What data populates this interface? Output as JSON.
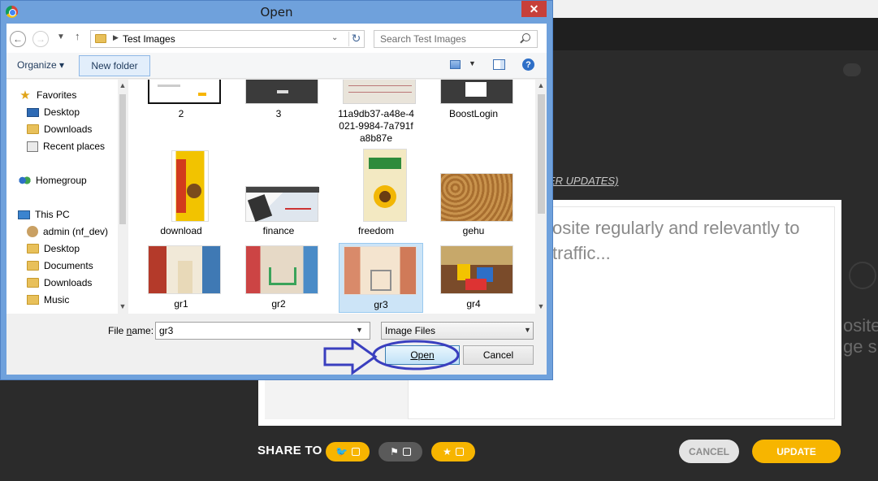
{
  "dialog": {
    "title": "Open",
    "address_path": "Test Images",
    "search_placeholder": "Search Test Images",
    "toolbar": {
      "organize_label": "Organize ▾",
      "new_folder_label": "New folder"
    },
    "nav": {
      "favorites": "Favorites",
      "desktop": "Desktop",
      "downloads": "Downloads",
      "recent": "Recent places",
      "homegroup": "Homegroup",
      "thispc": "This PC",
      "admin": "admin (nf_dev)",
      "pc_desktop": "Desktop",
      "documents": "Documents",
      "pc_downloads": "Downloads",
      "music": "Music"
    },
    "files": {
      "f2": "2",
      "f3": "3",
      "f_hash": "11a9db37-a48e-4021-9984-7a791fa8b87e",
      "f_boost": "BoostLogin",
      "f_download": "download",
      "f_finance": "finance",
      "f_freedom": "freedom",
      "f_gehu": "gehu",
      "f_gr1": "gr1",
      "f_gr2": "gr2",
      "f_gr3": "gr3",
      "f_gr4": "gr4",
      "selected": "gr3"
    },
    "file_name_label_pre": "File ",
    "file_name_label_u": "n",
    "file_name_label_post": "ame:",
    "file_name_value": "gr3",
    "file_type_value": "Image Files",
    "open_label": "Open",
    "cancel_label": "Cancel"
  },
  "background": {
    "updates_link": "ER UPDATES)",
    "placeholder_line1": "osite regularly and relevantly to",
    "placeholder_line2": "traffic...",
    "side_text_1": "osite",
    "side_text_2": "ge s",
    "share_label": "SHARE TO",
    "cancel_label": "CANCEL",
    "update_label": "UPDATE",
    "colors": {
      "accent": "#f7b500",
      "dark": "#2b2b2b"
    }
  },
  "annotation": {
    "color": "#3a3fbf"
  }
}
